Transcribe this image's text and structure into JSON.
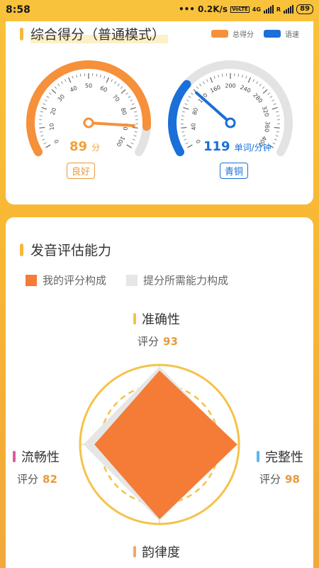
{
  "status_bar": {
    "time": "8:58",
    "dots": "•••",
    "net_speed": "0.2K/s",
    "volte": "VoLTE",
    "network": "4G",
    "roaming": "R",
    "battery": "89"
  },
  "overall": {
    "title": "综合得分（普通模式）",
    "legend": [
      {
        "label": "总得分",
        "color": "#f6903a"
      },
      {
        "label": "语速",
        "color": "#1a6fd8"
      }
    ],
    "score_gauge": {
      "value": 89,
      "max": 100,
      "ticks": [
        "0",
        "10",
        "20",
        "30",
        "40",
        "50",
        "60",
        "70",
        "80",
        "90",
        "100"
      ],
      "value_text": "89",
      "unit": "分",
      "badge": "良好",
      "color": "#f6903a"
    },
    "speed_gauge": {
      "value": 119,
      "max": 400,
      "ticks": [
        "0",
        "40",
        "80",
        "120",
        "160",
        "200",
        "240",
        "280",
        "320",
        "360",
        "400"
      ],
      "value_text": "119",
      "unit": "单词/分钟",
      "badge": "青铜",
      "color": "#1a6fd8"
    }
  },
  "pronunciation": {
    "title": "发音评估能力",
    "legend": [
      {
        "label": "我的评分构成",
        "color": "#f47c37"
      },
      {
        "label": "提分所需能力构成",
        "color": "#e6e6e6"
      }
    ],
    "score_prefix": "评分",
    "dimensions": [
      {
        "name": "准确性",
        "score": "93",
        "value": 93,
        "color": "#f2c14e"
      },
      {
        "name": "完整性",
        "score": "98",
        "value": 98,
        "color": "#5bb8f0"
      },
      {
        "name": "韵律度",
        "score": "",
        "value": 94,
        "color": "#f4a46a"
      },
      {
        "name": "流畅性",
        "score": "82",
        "value": 82,
        "color": "#e05a9c"
      }
    ]
  }
}
